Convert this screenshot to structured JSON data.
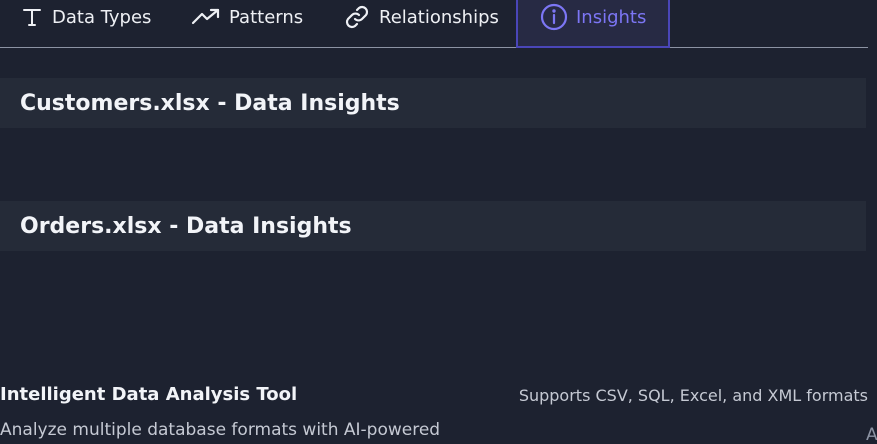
{
  "tabs": [
    {
      "label": "Data Types",
      "icon": "text-type-icon",
      "active": false
    },
    {
      "label": "Patterns",
      "icon": "trending-up-icon",
      "active": false
    },
    {
      "label": "Relationships",
      "icon": "link-icon",
      "active": false
    },
    {
      "label": "Insights",
      "icon": "info-circle-icon",
      "active": true
    }
  ],
  "sections": [
    {
      "title": "Customers.xlsx - Data Insights"
    },
    {
      "title": "Orders.xlsx - Data Insights"
    }
  ],
  "footer": {
    "title": "Intelligent Data Analysis Tool",
    "description": "Analyze multiple database formats with AI-powered",
    "formats": "Supports CSV, SQL, Excel, and XML formats",
    "clipped_char": "A"
  },
  "colors": {
    "background": "#1d2230",
    "section_bg": "#252b38",
    "accent": "#7c76f5",
    "active_tab_bg": "#272a44"
  }
}
